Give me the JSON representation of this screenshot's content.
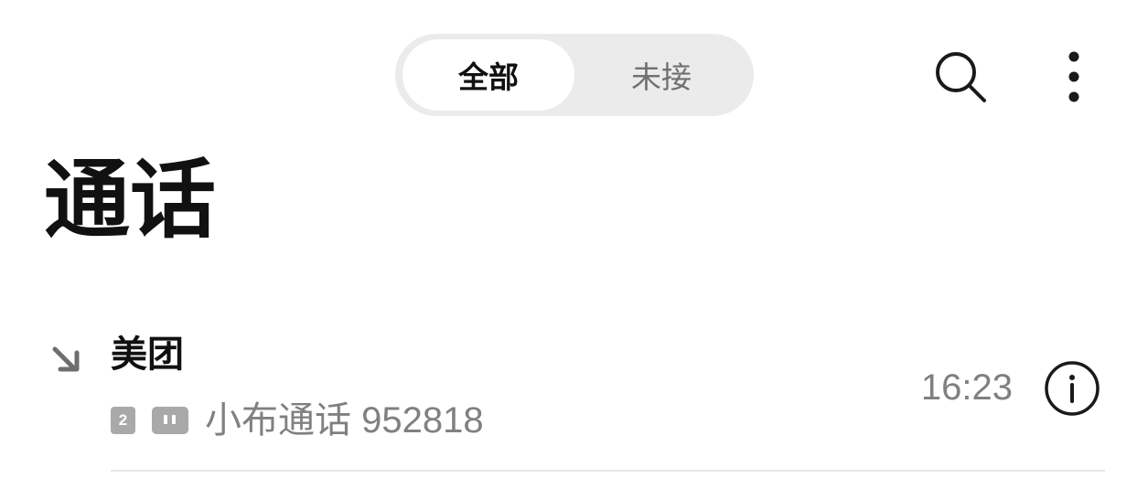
{
  "tabs": [
    {
      "label": "全部",
      "active": true
    },
    {
      "label": "未接",
      "active": false
    }
  ],
  "toolbar": {
    "search_icon": "search-icon",
    "more_icon": "more-vertical-icon"
  },
  "page_title": "通话",
  "calls": [
    {
      "direction_icon": "incoming-call-arrow-icon",
      "name": "美团",
      "sim_slot": "2",
      "hd_icon": "hd-call-icon",
      "location": "小布通话 952818",
      "time": "16:23",
      "info_icon": "info-icon"
    }
  ],
  "colors": {
    "segment_bg": "#ebebeb",
    "text_primary": "#111111",
    "text_secondary": "#808080",
    "badge_gray": "#a9a9a9"
  }
}
